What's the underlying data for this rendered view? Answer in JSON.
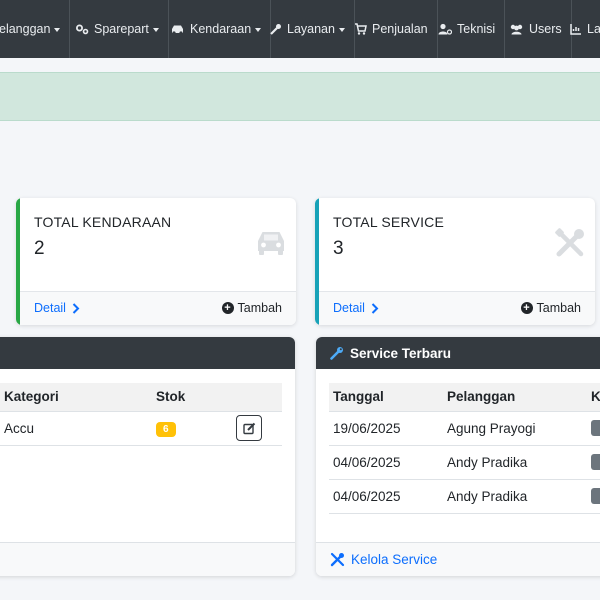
{
  "nav": {
    "items": [
      {
        "label": "elanggan",
        "icon": "users-icon",
        "dropdown": true
      },
      {
        "label": "Sparepart",
        "icon": "cogs-icon",
        "dropdown": true
      },
      {
        "label": "Kendaraan",
        "icon": "car-icon",
        "dropdown": true
      },
      {
        "label": "Layanan",
        "icon": "wrench-icon",
        "dropdown": true
      },
      {
        "label": "Penjualan",
        "icon": "cart-icon",
        "dropdown": false
      },
      {
        "label": "Teknisi",
        "icon": "user-gear-icon",
        "dropdown": false
      },
      {
        "label": "Users",
        "icon": "users-group-icon",
        "dropdown": false
      },
      {
        "label": "Lap",
        "icon": "chart-icon",
        "dropdown": false
      }
    ]
  },
  "cards": [
    {
      "title": "TOTAL KENDARAAN",
      "value": "2",
      "icon": "car-icon",
      "accent": "#28a745",
      "detail": "Detail",
      "add": "Tambah"
    },
    {
      "title": "TOTAL SERVICE",
      "value": "3",
      "icon": "tools-icon",
      "accent": "#17a2b8",
      "detail": "Detail",
      "add": "Tambah"
    }
  ],
  "sparepart_panel": {
    "headers": [
      "Kategori",
      "Stok"
    ],
    "rows": [
      {
        "kategori": "Accu",
        "stok": "6"
      }
    ]
  },
  "service_panel": {
    "title": "Service Terbaru",
    "headers": [
      "Tanggal",
      "Pelanggan",
      "K"
    ],
    "rows": [
      {
        "tanggal": "19/06/2025",
        "pelanggan": "Agung Prayogi"
      },
      {
        "tanggal": "04/06/2025",
        "pelanggan": "Andy Pradika"
      },
      {
        "tanggal": "04/06/2025",
        "pelanggan": "Andy Pradika"
      }
    ],
    "footer": "Kelola Service"
  },
  "colors": {
    "navbar": "#343a40",
    "link": "#0d6efd",
    "alert": "#d1e7dd",
    "warning": "#ffc107"
  }
}
